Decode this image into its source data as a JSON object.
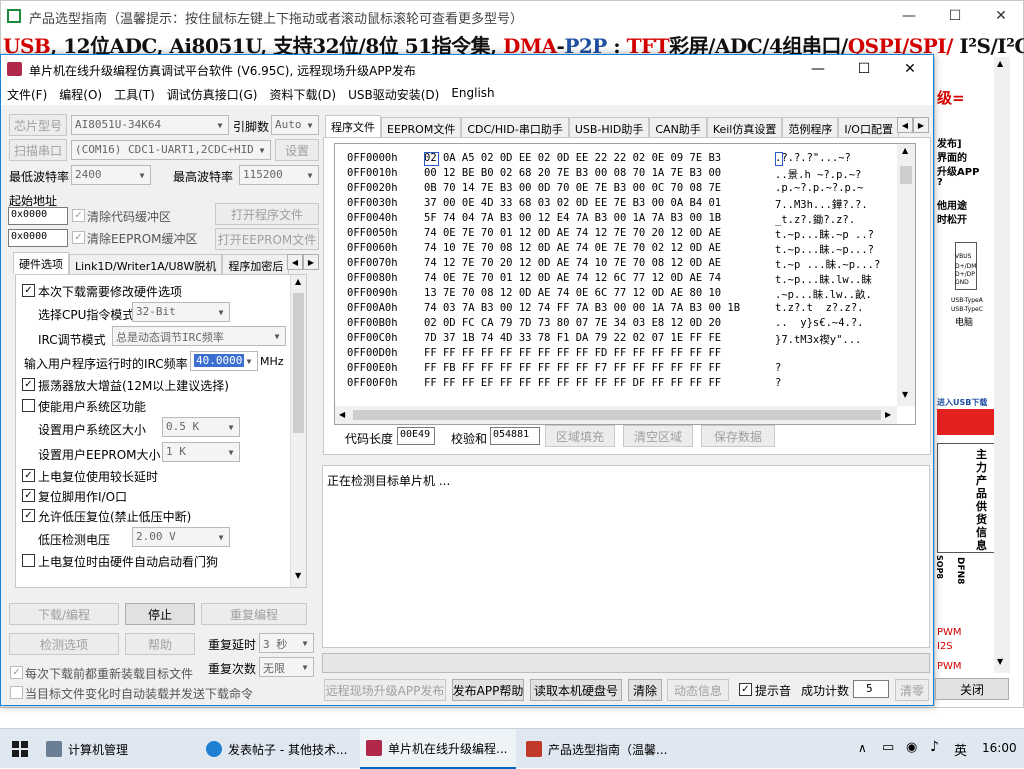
{
  "background_window": {
    "title": "产品选型指南（温馨提示：按住鼠标左键上下拖动或者滚动鼠标滚轮可查看更多型号）",
    "banner": {
      "parts": [
        {
          "text": "USB",
          "color": "#d40000"
        },
        {
          "text": ", 12位ADC, Ai8051U, 支持32位/8位 51指令集, ",
          "color": "#111111"
        },
        {
          "text": "DMA",
          "color": "#d40000"
        },
        {
          "text": "-",
          "color": "#111111"
        },
        {
          "text": "P2P",
          "color": "#1f4fa0"
        },
        {
          "text": " : ",
          "color": "#111111"
        },
        {
          "text": "TFT",
          "color": "#d40000"
        },
        {
          "text": "彩屏/ADC/4组串口/",
          "color": "#111111"
        },
        {
          "text": "QSPI/SPI/",
          "color": "#d40000"
        },
        {
          "text": " I²S/I²C",
          "color": "#111111"
        }
      ]
    },
    "side_texts": [
      "级=",
      "发布]",
      "界面的",
      "升级APP",
      "?",
      "他用途",
      "时松开",
      "VBUS",
      "D+/DM",
      "D+/DP",
      "GND",
      "USB-TypeA",
      "USB-TypeC",
      "电脑",
      "进入USB下载",
      "主力产品供货信息",
      "SOP8",
      "DFN8",
      "PWM",
      "I2S",
      "PWM"
    ]
  },
  "window": {
    "title": "单片机在线升级编程仿真调试平台软件 (V6.95C), 远程现场升级APP发布"
  },
  "menu": [
    "文件(F)",
    "编程(O)",
    "工具(T)",
    "调试仿真接口(G)",
    "资料下载(D)",
    "USB驱动安装(D)",
    "English"
  ],
  "left": {
    "chip_label": "芯片型号",
    "chip_value": "AI8051U-34K64",
    "freq_label": "引脚数",
    "freq_value": "Auto",
    "scan_label": "扫描串口",
    "port_value": "(COM16) CDC1-UART1,2CDC+HID",
    "settings_label": "设置",
    "min_baud_label": "最低波特率",
    "min_baud_value": "2400",
    "max_baud_label": "最高波特率",
    "max_baud_value": "115200",
    "start_addr_label": "起始地址",
    "addr1": "0x0000",
    "clear_code_label": "清除代码缓冲区",
    "open_prog_label": "打开程序文件",
    "addr2": "0x0000",
    "clear_eeprom_label": "清除EEPROM缓冲区",
    "open_eeprom_label": "打开EEPROM文件",
    "tabs": [
      "硬件选项",
      "Link1D/Writer1A/U8W脱机",
      "程序加密后"
    ],
    "hw": {
      "opt1": "本次下载需要修改硬件选项",
      "cpu_mode_label": "选择CPU指令模式",
      "cpu_mode_value": "32-Bit",
      "irc_mode_label": "IRC调节模式",
      "irc_mode_value": "总是动态调节IRC频率",
      "irc_freq_label": "输入用户程序运行时的IRC频率",
      "irc_freq_value": "40.0000",
      "irc_unit": "MHz",
      "opt2": "振荡器放大增益(12M以上建议选择)",
      "opt3": "使能用户系统区功能",
      "sys_size_label": "设置用户系统区大小",
      "sys_size_value": "0.5 K",
      "eeprom_size_label": "设置用户EEPROM大小",
      "eeprom_size_value": "1    K",
      "opt4": "上电复位使用较长延时",
      "opt5": "复位脚用作I/O口",
      "opt6": "允许低压复位(禁止低压中断)",
      "lvd_label": "低压检测电压",
      "lvd_value": "2.00 V",
      "opt7": "上电复位时由硬件自动启动看门狗"
    },
    "download_label": "下载/编程",
    "stop_label": "停止",
    "reprog_label": "重复编程",
    "detect_label": "检测选项",
    "help_label": "帮助",
    "retry_delay_label": "重复延时",
    "retry_delay_value": "3 秒",
    "retry_count_label": "重复次数",
    "retry_count_value": "无限",
    "reload_label": "每次下载前都重新装载目标文件",
    "autoload_label": "当目标文件变化时自动装载并发送下载命令"
  },
  "right": {
    "tabs": [
      "程序文件",
      "EEPROM文件",
      "CDC/HID-串口助手",
      "USB-HID助手",
      "CAN助手",
      "Keil仿真设置",
      "范例程序",
      "I/O口配置"
    ],
    "hex_rows": [
      {
        "addr": "0FF0000h",
        "data": "02 0A A5 02 0D EE 02 0D EE 22 22 02 0E 09 7E B3",
        "ascii": ".?.?.?\"...~?"
      },
      {
        "addr": "0FF0010h",
        "data": "00 12 BE B0 02 68 20 7E B3 00 08 70 1A 7E B3 00",
        "ascii": "..景.h ~?.p.~?"
      },
      {
        "addr": "0FF0020h",
        "data": "0B 70 14 7E B3 00 0D 70 0E 7E B3 00 0C 70 08 7E",
        "ascii": ".p.~?.p.~?.p.~"
      },
      {
        "addr": "0FF0030h",
        "data": "37 00 0E 4D 33 68 03 02 0D EE 7E B3 00 0A B4 01",
        "ascii": "7..M3h...鏵?.?."
      },
      {
        "addr": "0FF0040h",
        "data": "5F 74 04 7A B3 00 12 E4 7A B3 00 1A 7A B3 00 1B",
        "ascii": "_t.z?.鋤?.z?."
      },
      {
        "addr": "0FF0050h",
        "data": "74 0E 7E 70 01 12 0D AE 74 12 7E 70 20 12 0D AE",
        "ascii": "t.~p...眛.~p ..?"
      },
      {
        "addr": "0FF0060h",
        "data": "74 10 7E 70 08 12 0D AE 74 0E 7E 70 02 12 0D AE",
        "ascii": "t.~p...眛.~p...?"
      },
      {
        "addr": "0FF0070h",
        "data": "74 12 7E 70 20 12 0D AE 74 10 7E 70 08 12 0D AE",
        "ascii": "t.~p ...眛.~p...?"
      },
      {
        "addr": "0FF0080h",
        "data": "74 0E 7E 70 01 12 0D AE 74 12 6C 77 12 0D AE 74",
        "ascii": "t.~p...眛.lw..眛"
      },
      {
        "addr": "0FF0090h",
        "data": "13 7E 70 08 12 0D AE 74 0E 6C 77 12 0D AE 80 10",
        "ascii": ".~p...眛.lw..畝."
      },
      {
        "addr": "0FF00A0h",
        "data": "74 03 7A B3 00 12 74 FF 7A B3 00 00 1A 7A B3 00 1B",
        "ascii": "t.z?.t  z?.z?."
      },
      {
        "addr": "0FF00B0h",
        "data": "02 0D FC CA 79 7D 73 80 07 7E 34 03 E8 12 0D 20",
        "ascii": "..  y}s€.~4.?."
      },
      {
        "addr": "0FF00C0h",
        "data": "7D 37 1B 74 4D 33 78 F1 DA 79 22 02 07 1E FF FE",
        "ascii": "}7.tM3x禊y\"..."
      },
      {
        "addr": "0FF00D0h",
        "data": "FF FF FF FF FF FF FF FF FF FD FF FF FF FF FF FF",
        "ascii": ""
      },
      {
        "addr": "0FF00E0h",
        "data": "FF FB FF FF FF FF FF FF FF F7 FF FF FF FF FF FF",
        "ascii": "?"
      },
      {
        "addr": "0FF00F0h",
        "data": "FF FF FF EF FF FF FF FF FF FF FF DF FF FF FF FF",
        "ascii": "?"
      }
    ],
    "code_len_label": "代码长度",
    "code_len_value": "00E49",
    "checksum_label": "校验和",
    "checksum_value": "054881",
    "fill_label": "区域填充",
    "clear_region_label": "清空区域",
    "save_label": "保存数据",
    "log_text": "正在检测目标单片机 ...",
    "bottom": {
      "remote_label": "远程现场升级APP发布",
      "publish_help_label": "发布APP帮助",
      "read_disk_label": "读取本机硬盘号",
      "clear_label": "清除",
      "anim_label": "动态信息",
      "sound_label": "提示音",
      "success_label": "成功计数",
      "success_value": "5",
      "reset_label": "清零",
      "close_label": "关闭"
    }
  },
  "taskbar": {
    "items": [
      {
        "label": "计算机管理",
        "color": "#6a7f95"
      },
      {
        "label": "发表帖子 - 其他技术...",
        "color": "#1f7fd0"
      },
      {
        "label": "单片机在线升级编程...",
        "color": "#b0294a"
      },
      {
        "label": "产品选型指南（温馨...",
        "color": "#c0392b"
      }
    ],
    "ime": "英",
    "time": "16:00"
  }
}
